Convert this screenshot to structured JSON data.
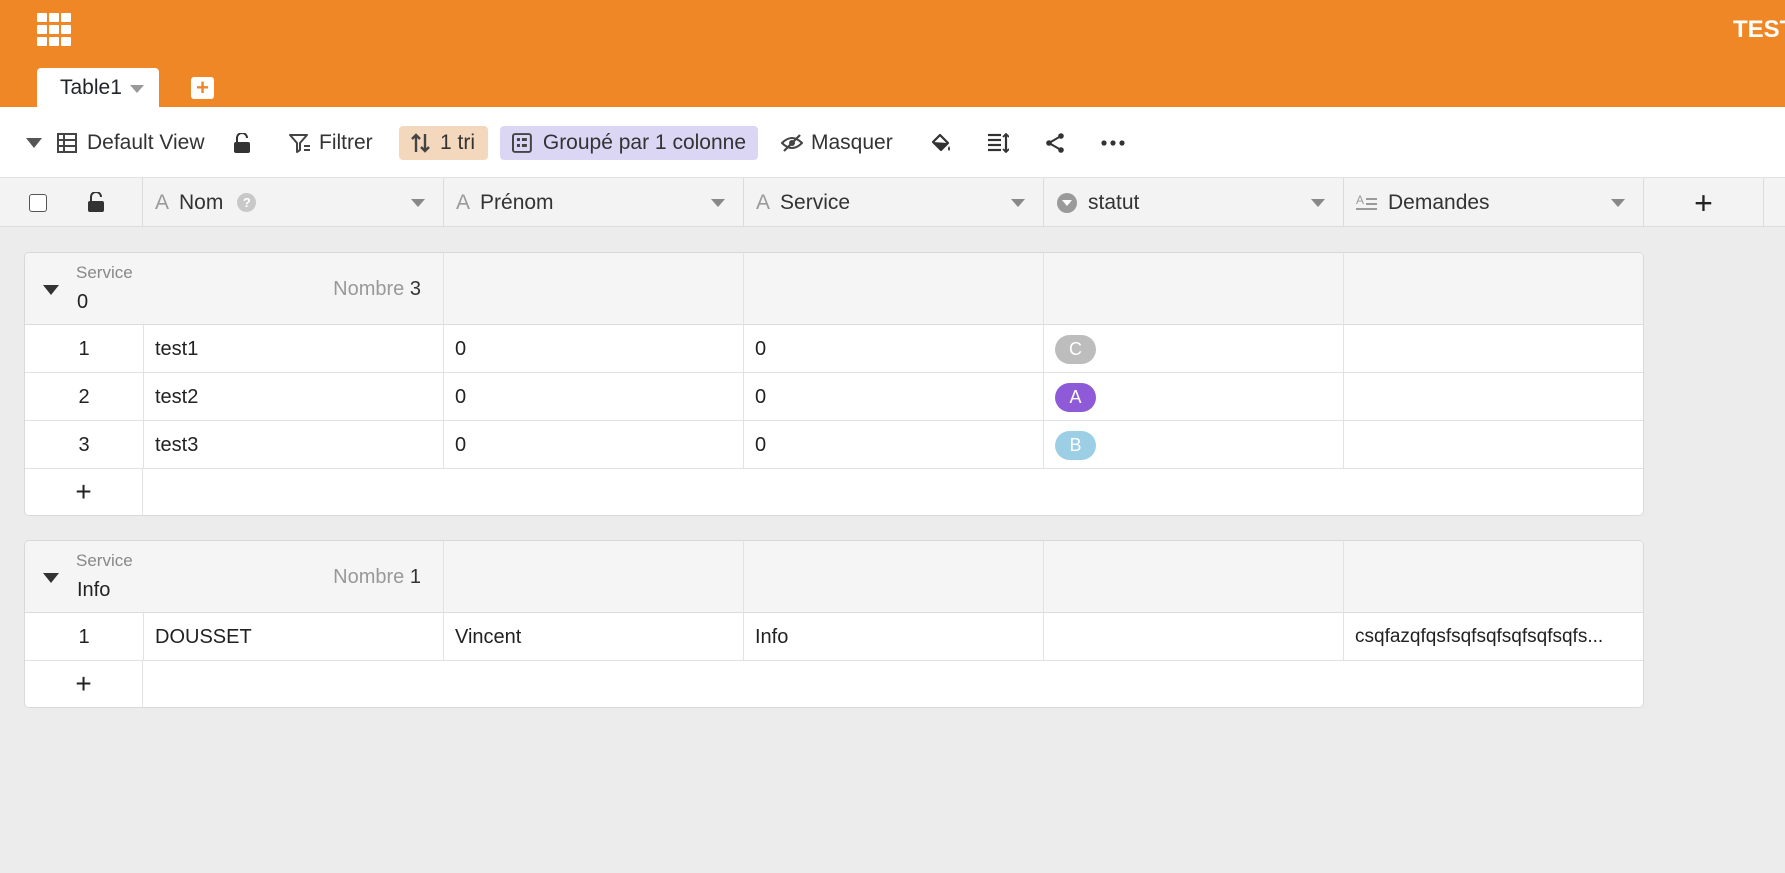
{
  "app": {
    "title": "TEST"
  },
  "tabs": [
    {
      "label": "Table1"
    }
  ],
  "toolbar": {
    "view_label": "Default View",
    "filter_label": "Filtrer",
    "sort_label": "1 tri",
    "group_label": "Groupé par 1 colonne",
    "hide_label": "Masquer"
  },
  "columns": [
    {
      "label": "Nom",
      "type": "text"
    },
    {
      "label": "Prénom",
      "type": "text"
    },
    {
      "label": "Service",
      "type": "text"
    },
    {
      "label": "statut",
      "type": "single-select"
    },
    {
      "label": "Demandes",
      "type": "long-text"
    }
  ],
  "groups": [
    {
      "label": "Service",
      "value": "0",
      "count_label": "Nombre",
      "count": "3",
      "rows": [
        {
          "index": "1",
          "nom": "test1",
          "prenom": "0",
          "service": "0",
          "statut": "C",
          "statut_color": "#bdbdbd",
          "demandes": ""
        },
        {
          "index": "2",
          "nom": "test2",
          "prenom": "0",
          "service": "0",
          "statut": "A",
          "statut_color": "#8e5ad8",
          "demandes": ""
        },
        {
          "index": "3",
          "nom": "test3",
          "prenom": "0",
          "service": "0",
          "statut": "B",
          "statut_color": "#9ccfe6",
          "demandes": ""
        }
      ]
    },
    {
      "label": "Service",
      "value": "Info",
      "count_label": "Nombre",
      "count": "1",
      "rows": [
        {
          "index": "1",
          "nom": "DOUSSET",
          "prenom": "Vincent",
          "service": "Info",
          "statut": "",
          "statut_color": "",
          "demandes": "csqfazqfqsfsqfsqfsqfsqfsqfs..."
        }
      ]
    }
  ],
  "colors": {
    "brand": "#ef8727",
    "sort_pill": "#f4d8bd",
    "group_pill": "#dcd6f5"
  }
}
